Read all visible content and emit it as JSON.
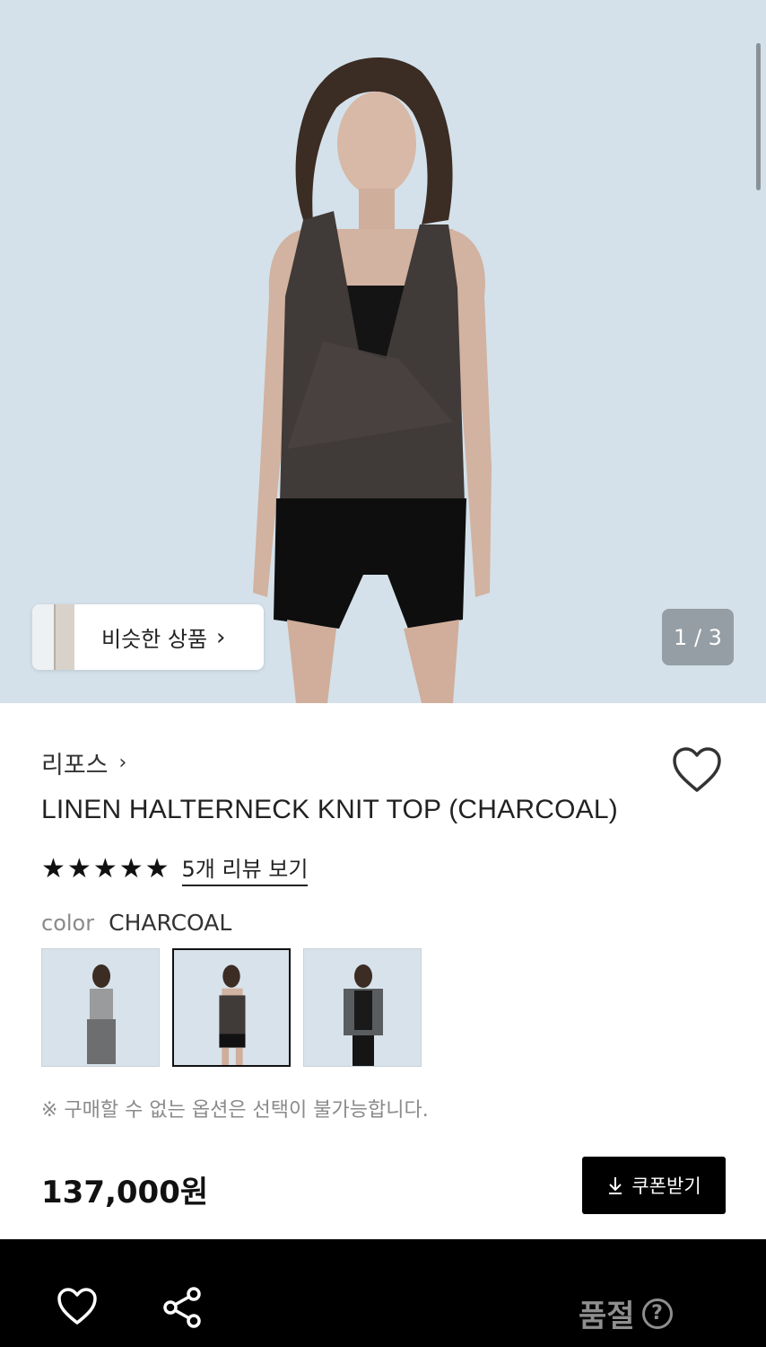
{
  "hero": {
    "similar_label": "비슷한 상품",
    "pager": "1 / 3"
  },
  "product": {
    "brand": "리포스",
    "title": "LINEN HALTERNECK KNIT TOP (CHARCOAL)",
    "rating_stars": 5,
    "review_link": "5개 리뷰 보기",
    "color_label": "color",
    "color_value": "CHARCOAL",
    "options": [
      "GRAY",
      "CHARCOAL",
      "BLACK"
    ],
    "selected_option": "CHARCOAL",
    "notice": "※ 구매할 수 없는 옵션은 선택이 불가능합니다.",
    "price": "137,000원",
    "coupon_label": "쿠폰받기"
  },
  "bottom_bar": {
    "status_label": "품절",
    "help_symbol": "?"
  },
  "icons": {
    "brand_chevron": "chevron-right-icon",
    "wishlist": "heart-outline-icon",
    "share": "share-icon",
    "download": "download-icon",
    "help": "question-circle-icon"
  },
  "colors": {
    "hero_background": "#d4e1ea",
    "bottom_bar": "#000000",
    "coupon_button": "#000000",
    "disabled_text": "#8e8e8e"
  }
}
